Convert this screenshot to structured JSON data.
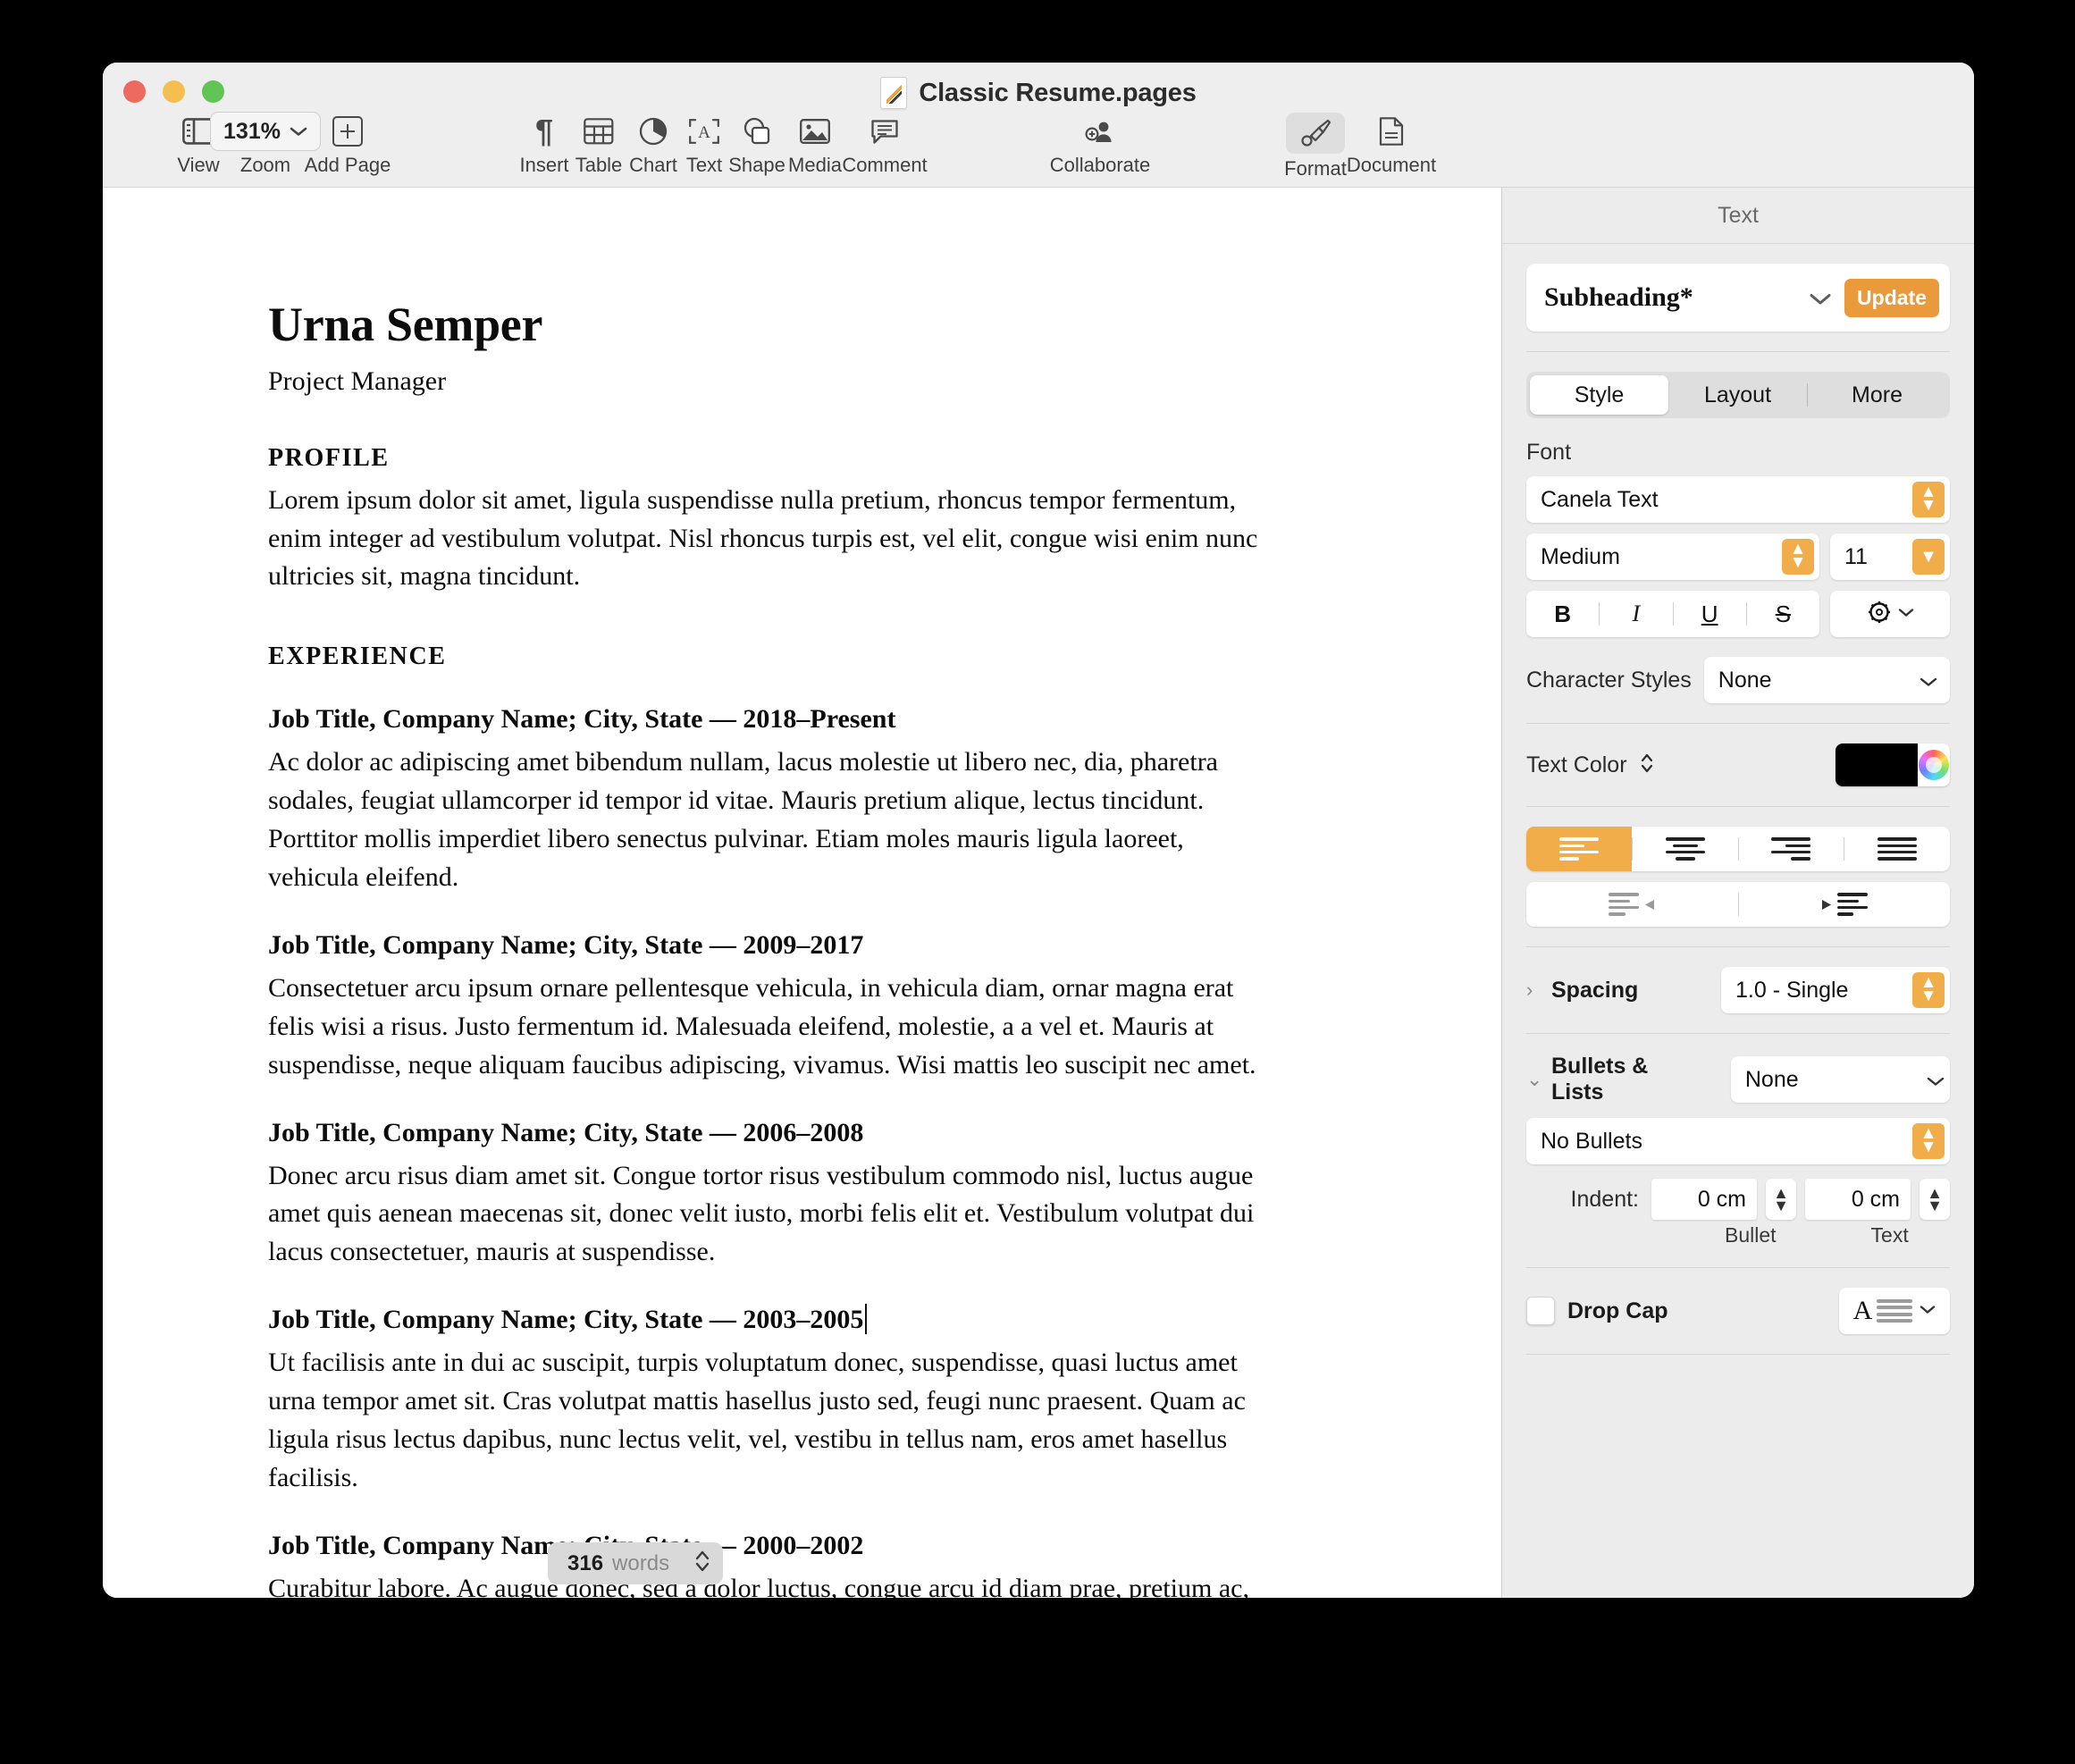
{
  "window": {
    "title": "Classic Resume.pages",
    "doc_icon": "pages-document-icon"
  },
  "toolbar": {
    "view": {
      "label": "View",
      "icon": "sidebar-toggle-icon"
    },
    "zoom": {
      "label": "Zoom",
      "value": "131%",
      "icon": "chevron-down-icon"
    },
    "add_page": {
      "label": "Add Page",
      "icon": "plus-box-icon"
    },
    "insert": {
      "label": "Insert",
      "icon": "pilcrow-icon"
    },
    "table": {
      "label": "Table",
      "icon": "table-icon"
    },
    "chart": {
      "label": "Chart",
      "icon": "pie-chart-icon"
    },
    "text": {
      "label": "Text",
      "icon": "text-box-icon"
    },
    "shape": {
      "label": "Shape",
      "icon": "shapes-icon"
    },
    "media": {
      "label": "Media",
      "icon": "image-icon"
    },
    "comment": {
      "label": "Comment",
      "icon": "comment-bubble-icon"
    },
    "collaborate": {
      "label": "Collaborate",
      "icon": "add-person-icon"
    },
    "format": {
      "label": "Format",
      "icon": "paintbrush-icon",
      "active": true
    },
    "document": {
      "label": "Document",
      "icon": "document-icon",
      "active": false
    }
  },
  "document": {
    "name": "Urna Semper",
    "role": "Project Manager",
    "sections": [
      {
        "heading": "PROFILE",
        "body": "Lorem ipsum dolor sit amet, ligula suspendisse nulla pretium, rhoncus tempor fermentum, enim integer ad vestibulum volutpat. Nisl rhoncus turpis est, vel elit, congue wisi enim nunc ultricies sit, magna tincidunt."
      },
      {
        "heading": "EXPERIENCE"
      }
    ],
    "experience": [
      {
        "title": "Job Title, Company Name; City, State — 2018–Present",
        "body": "Ac dolor ac adipiscing amet bibendum nullam, lacus molestie ut libero nec, dia, pharetra sodales, feugiat ullamcorper id tempor id vitae. Mauris pretium alique, lectus tincidunt. Porttitor mollis imperdiet libero senectus pulvinar. Etiam moles mauris ligula laoreet, vehicula eleifend."
      },
      {
        "title": "Job Title, Company Name; City, State — 2009–2017",
        "body": "Consectetuer arcu ipsum ornare pellentesque vehicula, in vehicula diam, ornar magna erat felis wisi a risus. Justo fermentum id. Malesuada eleifend, molestie, a a vel et. Mauris at suspendisse, neque aliquam faucibus adipiscing, vivamus. Wisi mattis leo suscipit nec amet."
      },
      {
        "title": "Job Title, Company Name; City, State — 2006–2008",
        "body": "Donec arcu risus diam amet sit. Congue tortor risus vestibulum commodo nisl, luctus augue amet quis aenean maecenas sit, donec velit iusto, morbi felis elit et. Vestibulum volutpat dui lacus consectetuer, mauris at suspendisse."
      },
      {
        "title": "Job Title, Company Name; City, State — 2003–2005",
        "body": "Ut facilisis ante in dui ac suscipit, turpis voluptatum donec, suspendisse, quasi luctus amet urna tempor amet sit. Cras volutpat mattis hasellus justo sed, feugi nunc praesent. Quam ac ligula risus lectus dapibus, nunc lectus velit, vel, vestibu in tellus nam, eros amet hasellus facilisis."
      },
      {
        "title": "Job Title, Company Name; City, State — 2000–2002",
        "body": "Curabitur labore. Ac augue donec, sed a dolor luctus, congue arcu id diam prae, pretium ac, ullamcorper non ha"
      }
    ]
  },
  "word_count": {
    "count": "316",
    "unit": "words",
    "stepper_icon": "up-down-stepper-icon"
  },
  "sidebar": {
    "header": "Text",
    "paragraph_style": {
      "name": "Subheading*",
      "chevron_icon": "chevron-down-icon",
      "update_label": "Update"
    },
    "tabs": [
      {
        "label": "Style",
        "active": true
      },
      {
        "label": "Layout",
        "active": false
      },
      {
        "label": "More",
        "active": false
      }
    ],
    "font": {
      "section_label": "Font",
      "family": "Canela Text",
      "weight": "Medium",
      "size": "11",
      "bold": "B",
      "italic": "I",
      "underline": "U",
      "strikethrough": "S",
      "gear_icon": "gear-icon"
    },
    "character_styles": {
      "label": "Character Styles",
      "value": "None"
    },
    "text_color": {
      "label": "Text Color",
      "swatch": "#000000",
      "wheel_icon": "color-wheel-icon"
    },
    "alignment": {
      "options": [
        "align-left",
        "align-center",
        "align-right",
        "align-justify"
      ],
      "active": "align-left",
      "outdent": "decrease-indent",
      "indent": "increase-indent"
    },
    "spacing": {
      "label": "Spacing",
      "value": "1.0 - Single",
      "disclosure": "collapsed"
    },
    "bullets_lists": {
      "label": "Bullets & Lists",
      "value": "None",
      "bullet_type": "No Bullets",
      "indent_label": "Indent:",
      "bullet_indent": "0 cm",
      "text_indent": "0 cm",
      "bullet_sublabel": "Bullet",
      "text_sublabel": "Text",
      "disclosure": "expanded"
    },
    "drop_cap": {
      "label": "Drop Cap",
      "checked": false,
      "preview_icon": "drop-cap-icon"
    }
  },
  "colors": {
    "accent": "#f0ad4a",
    "update_button": "#eb9a3b",
    "toolbar_bg": "#eeeeee",
    "sidebar_bg": "#ececec"
  }
}
